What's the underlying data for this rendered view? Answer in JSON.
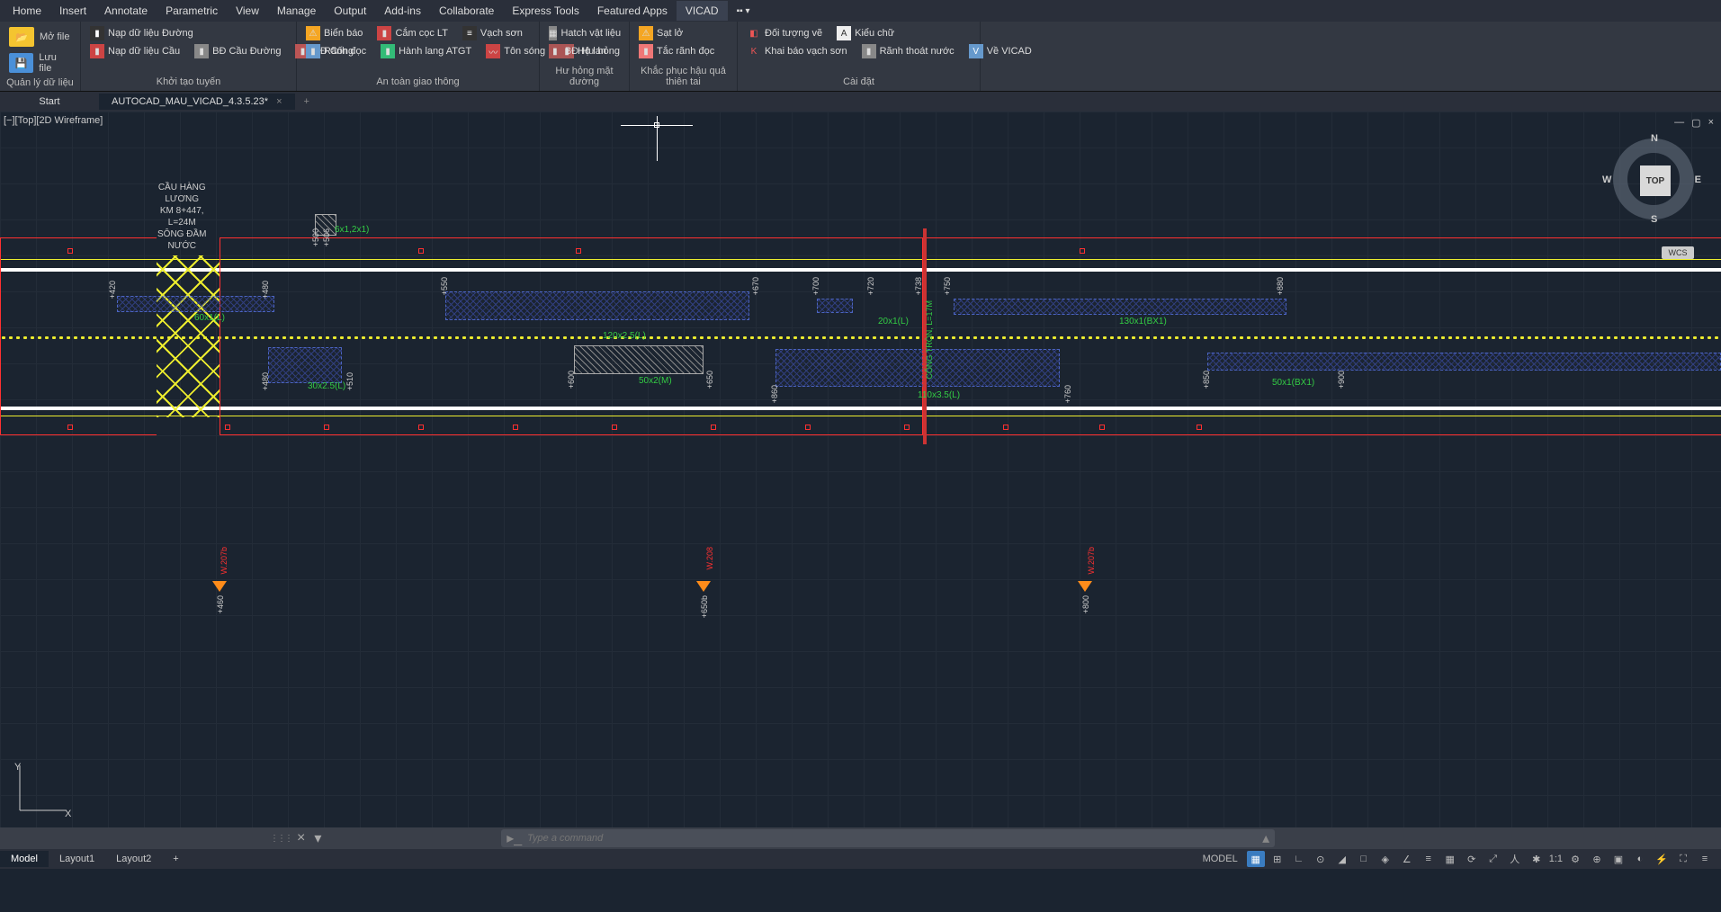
{
  "menu": [
    "Home",
    "Insert",
    "Annotate",
    "Parametric",
    "View",
    "Manage",
    "Output",
    "Add-ins",
    "Collaborate",
    "Express Tools",
    "Featured Apps",
    "VICAD"
  ],
  "menu_active": 11,
  "ribbon": {
    "p0": {
      "title": "Quản lý dữ liệu",
      "open": "Mở file",
      "save": "Lưu file"
    },
    "p1": {
      "title": "Khởi tạo tuyến",
      "a": "Nạp dữ liệu Đường",
      "b": "Nạp dữ liệu Cầu",
      "c": "BĐ Cầu Đường",
      "d": "BĐ Cống"
    },
    "p2": {
      "title": "An toàn giao thông",
      "a": "Biển báo",
      "b": "Cắm cọc LT",
      "c": "Vạch sơn",
      "d": "Rãnh đọc",
      "e": "Hành lang ATGT",
      "f": "Tôn sóng",
      "g": "Hộ lan"
    },
    "p3": {
      "title": "Hư hỏng mặt đường",
      "a": "Hatch vật liệu",
      "b": "BĐ Hư hỏng"
    },
    "p4": {
      "title": "Khắc phục hậu quả thiên tai",
      "a": "Sạt lở",
      "b": "Tắc rãnh đọc"
    },
    "p5": {
      "title": "Cài đặt",
      "a": "Đối tượng vẽ",
      "b": "Kiểu chữ",
      "c": "Khai báo vạch sơn",
      "d": "Rãnh thoát nước",
      "e": "Về VICAD"
    }
  },
  "tabs": {
    "start": "Start",
    "file": "AUTOCAD_MAU_VICAD_4.3.5.23*"
  },
  "viewlabel": "[−][Top][2D Wireframe]",
  "cube": {
    "top": "TOP",
    "n": "N",
    "e": "E",
    "s": "S",
    "w": "W"
  },
  "wcs": "WCS",
  "ucs": {
    "x": "X",
    "y": "Y"
  },
  "drawing": {
    "title": "CẦU HÀNG\nLƯƠNG\nKM 8+447,\nL=24M\nSÔNG ĐẦM\nNƯỚC",
    "g": {
      "a": "6x1,2x1)",
      "b": "60x1(L)",
      "c": "30x2.5(L)",
      "d": "120x2.5(L)",
      "e": "50x2(M)",
      "f": "20x1(L)",
      "g": "110x3.5(L)",
      "h": "130x1(BX1)",
      "i": "50x1(BX1)"
    },
    "v": {
      "a": "+420",
      "b": "+480",
      "c": "+480",
      "d": "+500",
      "e": "+506",
      "f": "+510",
      "g": "+550",
      "h": "+670",
      "i": "+700",
      "j": "+720",
      "k": "+738",
      "l": "+750",
      "m": "+880",
      "n": "+600",
      "o": "+650",
      "p": "+860",
      "q": "+760",
      "r": "+850",
      "s": "+900",
      "t": "+460",
      "u": "+650b",
      "w": "+800"
    },
    "cong": "CỐNG TRÒN, L=17M",
    "signs": {
      "a": "W.207b",
      "b": "W.208",
      "c": "W.207b"
    }
  },
  "cmd": {
    "placeholder": "Type a command"
  },
  "status": {
    "model": "Model",
    "l1": "Layout1",
    "l2": "Layout2",
    "mlabel": "MODEL",
    "scale": "1:1"
  }
}
